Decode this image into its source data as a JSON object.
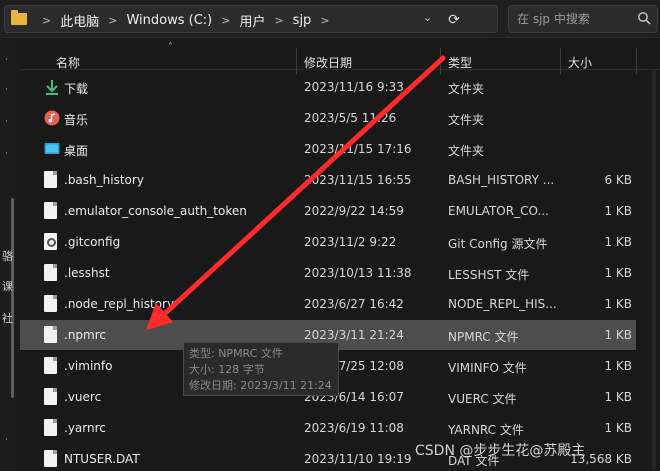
{
  "address": {
    "crumbs": [
      "此电脑",
      "Windows (C:)",
      "用户",
      "sjp"
    ],
    "refresh_glyph": "⟳"
  },
  "search": {
    "placeholder": "在 sjp 中搜索"
  },
  "nav": {
    "chars": [
      "骆",
      "课",
      "社"
    ],
    "dots": [
      "˙",
      "˙",
      "˙",
      "˙",
      "˙"
    ]
  },
  "columns": {
    "name": "名称",
    "date": "修改日期",
    "type": "类型",
    "size": "大小"
  },
  "files": [
    {
      "icon": "download-icon",
      "name": "下载",
      "date": "2023/11/16 9:33",
      "type": "文件夹",
      "size": ""
    },
    {
      "icon": "music-icon",
      "name": "音乐",
      "date": "2023/5/5 11:26",
      "type": "文件夹",
      "size": ""
    },
    {
      "icon": "desktop-icon",
      "name": "桌面",
      "date": "2023/11/15 17:16",
      "type": "文件夹",
      "size": ""
    },
    {
      "icon": "file-icon",
      "name": ".bash_history",
      "date": "2023/11/15 16:55",
      "type": "BASH_HISTORY ...",
      "size": "6 KB"
    },
    {
      "icon": "file-icon",
      "name": ".emulator_console_auth_token",
      "date": "2022/9/22 14:59",
      "type": "EMULATOR_CO...",
      "size": "1 KB"
    },
    {
      "icon": "gear-file-icon",
      "name": ".gitconfig",
      "date": "2023/11/2 9:22",
      "type": "Git Config 源文件",
      "size": "1 KB"
    },
    {
      "icon": "file-icon",
      "name": ".lesshst",
      "date": "2023/10/13 11:38",
      "type": "LESSHST 文件",
      "size": "1 KB"
    },
    {
      "icon": "file-icon",
      "name": ".node_repl_history",
      "date": "2023/6/27 16:42",
      "type": "NODE_REPL_HIS...",
      "size": "1 KB"
    },
    {
      "icon": "file-icon",
      "name": ".npmrc",
      "date": "2023/3/11 21:24",
      "type": "NPMRC 文件",
      "size": "1 KB",
      "selected": true
    },
    {
      "icon": "file-icon",
      "name": ".viminfo",
      "date": "2023/7/25 12:08",
      "type": "VIMINFO 文件",
      "size": "1 KB"
    },
    {
      "icon": "file-icon",
      "name": ".vuerc",
      "date": "2023/6/14 16:07",
      "type": "VUERC 文件",
      "size": "1 KB"
    },
    {
      "icon": "file-icon",
      "name": ".yarnrc",
      "date": "2023/6/19 11:08",
      "type": "YARNRC 文件",
      "size": "1 KB"
    },
    {
      "icon": "file-icon",
      "name": "NTUSER.DAT",
      "date": "2023/11/10 19:19",
      "type": "DAT 文件",
      "size": "13,568 KB"
    }
  ],
  "tooltip": {
    "line1": "类型: NPMRC 文件",
    "line2": "大小: 128 字节",
    "line3": "修改日期: 2023/3/11 21:24"
  },
  "watermark": "CSDN @步步生花@苏殿主",
  "colors": {
    "selected_row": "#4d4d4d",
    "arrow": "#ff2a2a",
    "folder": "#e8b43c"
  }
}
